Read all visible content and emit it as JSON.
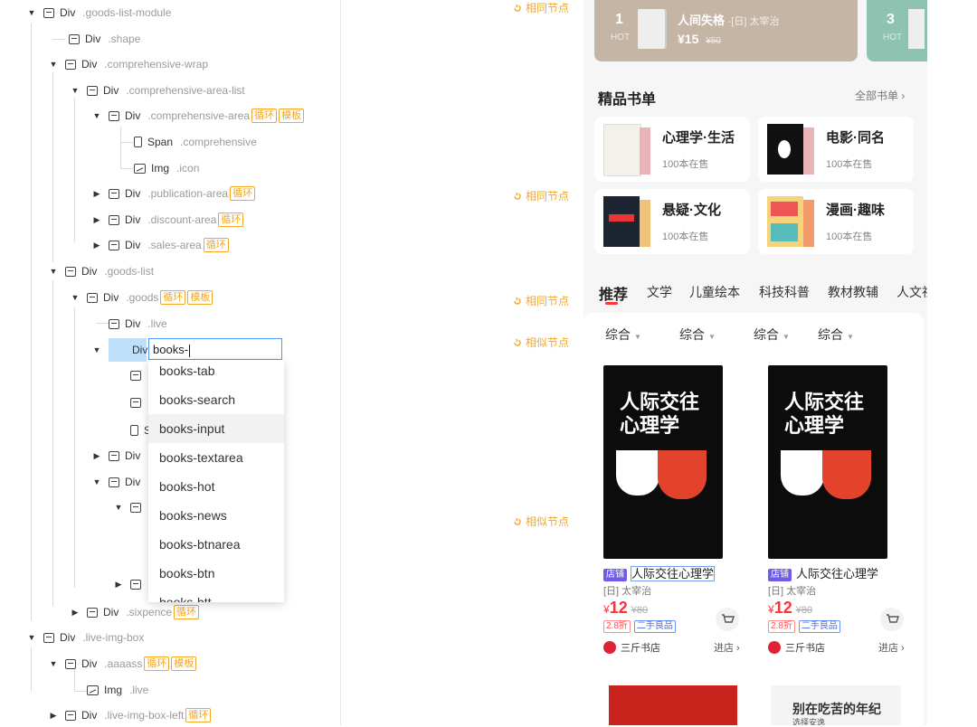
{
  "tree": {
    "rows": [
      {
        "name": "Div",
        "cls": ".goods-list-module",
        "tags": []
      },
      {
        "name": "Div",
        "cls": ".shape",
        "tags": []
      },
      {
        "name": "Div",
        "cls": ".comprehensive-wrap",
        "tags": []
      },
      {
        "name": "Div",
        "cls": ".comprehensive-area-list",
        "tags": []
      },
      {
        "name": "Div",
        "cls": ".comprehensive-area",
        "tags": [
          "循环",
          "模板"
        ]
      },
      {
        "name": "Span",
        "cls": ".comprehensive",
        "tags": []
      },
      {
        "name": "Img",
        "cls": ".icon",
        "tags": []
      },
      {
        "name": "Div",
        "cls": ".publication-area",
        "tags": [
          "循环"
        ]
      },
      {
        "name": "Div",
        "cls": ".discount-area",
        "tags": [
          "循环"
        ]
      },
      {
        "name": "Div",
        "cls": ".sales-area",
        "tags": [
          "循环"
        ]
      },
      {
        "name": "Div",
        "cls": ".goods-list",
        "tags": []
      },
      {
        "name": "Div",
        "cls": ".goods",
        "tags": [
          "循环",
          "模板"
        ]
      },
      {
        "name": "Div",
        "cls": ".live",
        "tags": []
      },
      {
        "name": "Div",
        "cls": "",
        "tags": []
      },
      {
        "name": "Spa",
        "cls": "",
        "tags": []
      },
      {
        "name": "Div",
        "cls": "",
        "tags": []
      },
      {
        "name": "Div",
        "cls": "",
        "tags": []
      },
      {
        "name": "Div",
        "cls": ".sixpence",
        "tags": [
          "循环"
        ]
      },
      {
        "name": "Div",
        "cls": ".live-img-box",
        "tags": []
      },
      {
        "name": "Div",
        "cls": ".aaaass",
        "tags": [
          "循环",
          "模板"
        ]
      },
      {
        "name": "Img",
        "cls": ".live",
        "tags": []
      },
      {
        "name": "Div",
        "cls": ".live-img-box-left",
        "tags": [
          "循环"
        ]
      }
    ],
    "rename_value": "books-",
    "selected_label": "Div",
    "suggestions": [
      "books-tab",
      "books-search",
      "books-input",
      "books-textarea",
      "books-hot",
      "books-news",
      "books-btnarea",
      "books-btn",
      "books-btt"
    ]
  },
  "markers": [
    "相同节点",
    "相同节点",
    "相同节点",
    "相似节点",
    "相似节点"
  ],
  "preview": {
    "hot": [
      {
        "rank": "1",
        "label": "HOT",
        "title": "人间失格",
        "author": "-[日] 太宰治",
        "price": "¥15",
        "old_price": "¥50"
      },
      {
        "rank": "3",
        "label": "HOT"
      }
    ],
    "booklist_title": "精品书单",
    "booklist_more": "全部书单 ›",
    "booklists": [
      {
        "title": "心理学·生活",
        "count": "100本在售"
      },
      {
        "title": "电影·同名",
        "count": "100本在售"
      },
      {
        "title": "悬疑·文化",
        "count": "100本在售"
      },
      {
        "title": "漫画·趣味",
        "count": "100本在售"
      }
    ],
    "tabs": [
      "推荐",
      "文学",
      "儿童绘本",
      "科技科普",
      "教材教辅",
      "人文社"
    ],
    "sorts": [
      "综合",
      "综合",
      "综合",
      "综合"
    ],
    "products": [
      {
        "badge": "店铺",
        "title": "人际交往心理学",
        "author": "[日] 太宰治",
        "price": "12",
        "old": "¥80",
        "tags": [
          "2.8折",
          "二手良品"
        ],
        "store": "三斤书店",
        "enter": "进店 ›",
        "cover_title": "人际交往心理学"
      },
      {
        "badge": "店铺",
        "title": "人际交往心理学",
        "author": "[日] 太宰治",
        "price": "12",
        "old": "¥80",
        "tags": [
          "2.8折",
          "二手良品"
        ],
        "store": "三斤书店",
        "enter": "进店 ›",
        "cover_title": "人际交往心理学"
      }
    ],
    "bottom_book_title": "别在吃苦的年纪",
    "bottom_book_sub": "选择安逸"
  },
  "colors": {
    "accent": "#f5a623",
    "selection": "#bfe0fb",
    "price": "#ff3333",
    "hot1": "#c4b5a5",
    "hot2": "#8ec2b1"
  }
}
